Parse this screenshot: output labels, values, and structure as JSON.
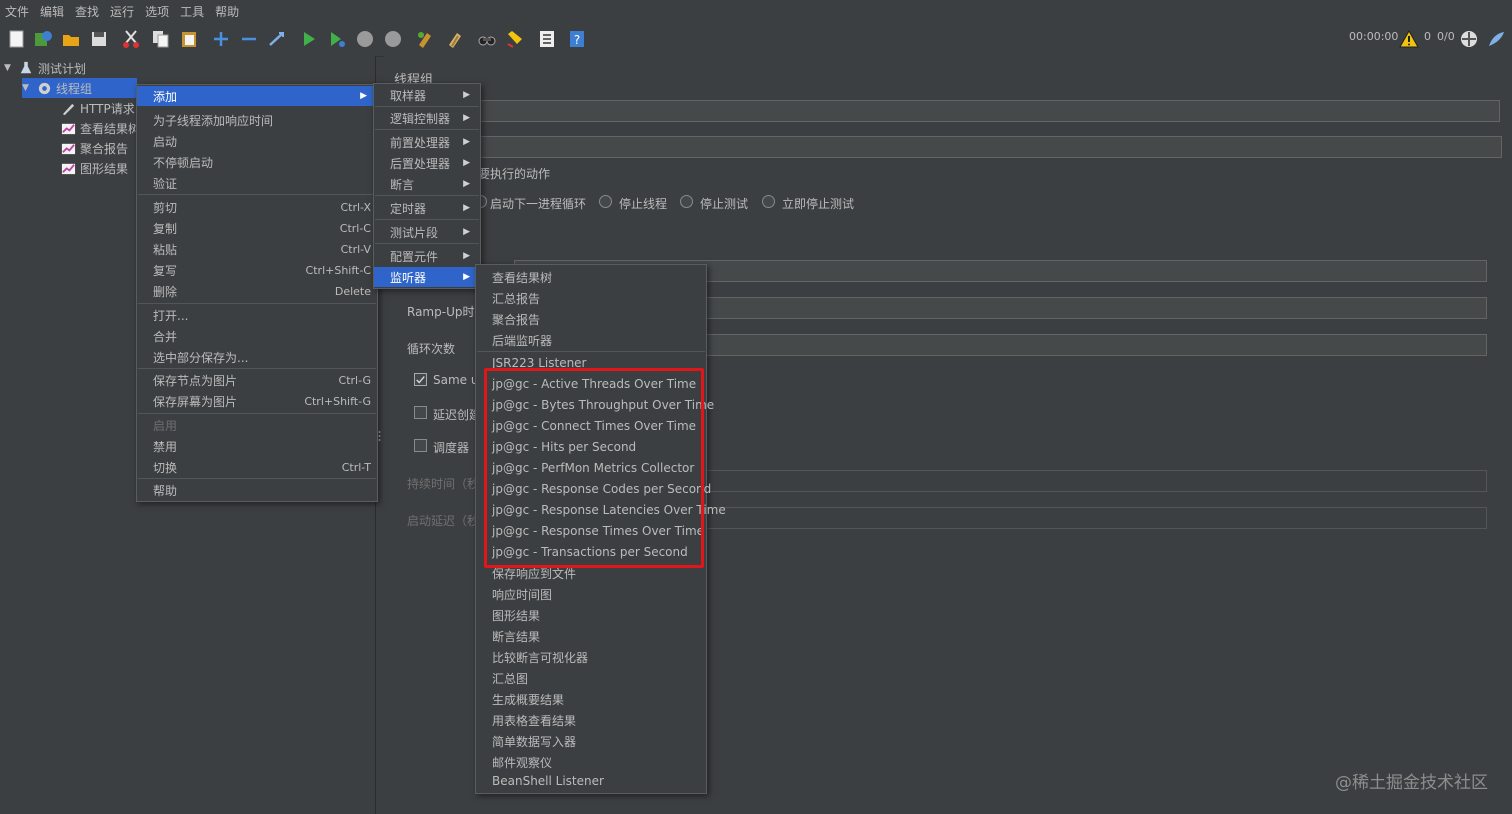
{
  "menubar": [
    "文件",
    "编辑",
    "查找",
    "运行",
    "选项",
    "工具",
    "帮助"
  ],
  "toolbar": {
    "timer": "00:00:00",
    "warnings": "0",
    "threads": "0/0"
  },
  "tree": {
    "root": "测试计划",
    "thread_group": "线程组",
    "children": [
      "HTTP请求",
      "查看结果树",
      "聚合报告",
      "图形结果"
    ]
  },
  "panel": {
    "title": "线程组",
    "action_label": "在取样器错误后要执行的动作",
    "radios": [
      "启动下一进程循环",
      "停止线程",
      "停止测试",
      "立即停止测试"
    ],
    "rampup_label": "Ramp-Up时间",
    "loop_label": "循环次数",
    "same_user": "Same user",
    "delay_label": "延迟创建",
    "scheduler_label": "调度器",
    "duration_label": "持续时间（秒）",
    "startup_delay_label": "启动延迟（秒）"
  },
  "context_menu": [
    {
      "label": "添加",
      "shortcut": "",
      "submenu": true
    },
    {
      "label": "为子线程添加响应时间",
      "shortcut": ""
    },
    {
      "label": "启动",
      "shortcut": ""
    },
    {
      "label": "不停顿启动",
      "shortcut": ""
    },
    {
      "label": "验证",
      "shortcut": ""
    },
    {
      "label": "剪切",
      "shortcut": "Ctrl-X"
    },
    {
      "label": "复制",
      "shortcut": "Ctrl-C"
    },
    {
      "label": "粘贴",
      "shortcut": "Ctrl-V"
    },
    {
      "label": "复写",
      "shortcut": "Ctrl+Shift-C"
    },
    {
      "label": "删除",
      "shortcut": "Delete"
    },
    {
      "label": "打开...",
      "shortcut": ""
    },
    {
      "label": "合并",
      "shortcut": ""
    },
    {
      "label": "选中部分保存为...",
      "shortcut": ""
    },
    {
      "label": "保存节点为图片",
      "shortcut": "Ctrl-G"
    },
    {
      "label": "保存屏幕为图片",
      "shortcut": "Ctrl+Shift-G"
    },
    {
      "label": "启用",
      "shortcut": ""
    },
    {
      "label": "禁用",
      "shortcut": ""
    },
    {
      "label": "切换",
      "shortcut": "Ctrl-T"
    },
    {
      "label": "帮助",
      "shortcut": ""
    }
  ],
  "add_submenu": [
    "取样器",
    "逻辑控制器",
    "前置处理器",
    "后置处理器",
    "断言",
    "定时器",
    "测试片段",
    "配置元件",
    "监听器"
  ],
  "listener_submenu": [
    "查看结果树",
    "汇总报告",
    "聚合报告",
    "后端监听器",
    "JSR223 Listener",
    "jp@gc - Active Threads Over Time",
    "jp@gc - Bytes Throughput Over Time",
    "jp@gc - Connect Times Over Time",
    "jp@gc - Hits per Second",
    "jp@gc - PerfMon Metrics Collector",
    "jp@gc - Response Codes per Second",
    "jp@gc - Response Latencies Over Time",
    "jp@gc - Response Times Over Time",
    "jp@gc - Transactions per Second",
    "保存响应到文件",
    "响应时间图",
    "图形结果",
    "断言结果",
    "比较断言可视化器",
    "汇总图",
    "生成概要结果",
    "用表格查看结果",
    "简单数据写入器",
    "邮件观察仪",
    "BeanShell Listener"
  ],
  "watermark": "@稀土掘金技术社区",
  "colors": {
    "background": "#3c3f41",
    "selection": "#2f65ca",
    "highlight_border": "#e0161b"
  }
}
